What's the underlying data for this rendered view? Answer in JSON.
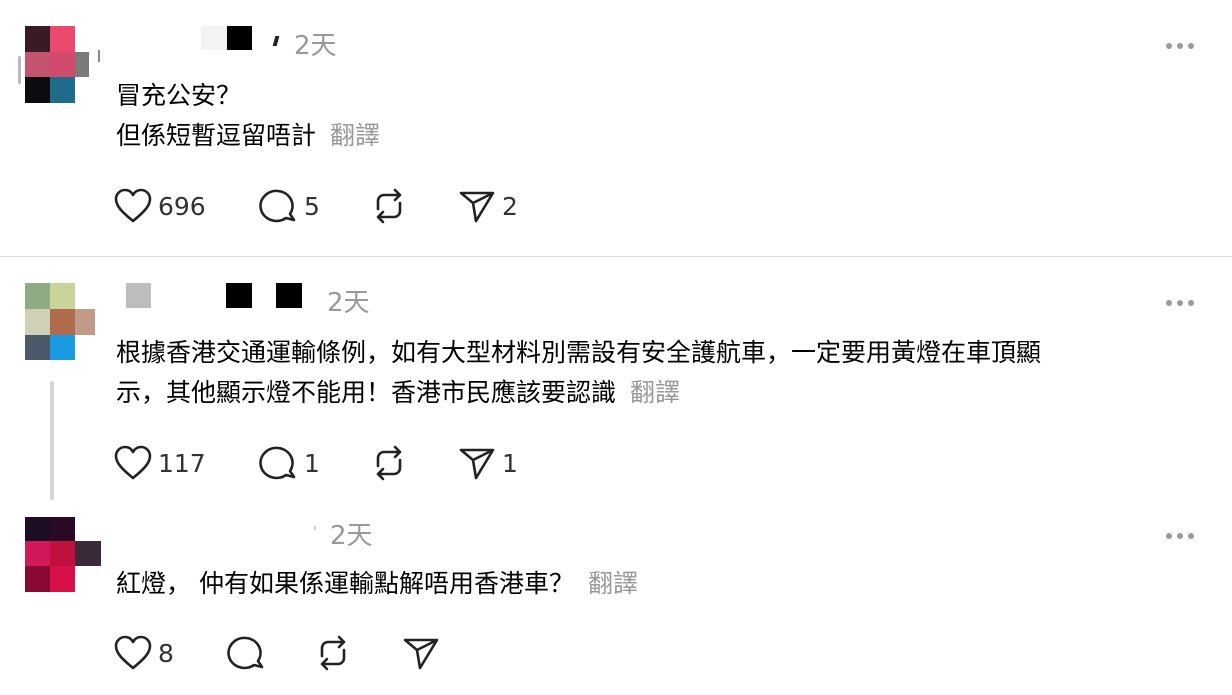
{
  "posts": [
    {
      "time": "2天",
      "lines": [
        "冒充公安？",
        "但係短暫逗留唔計"
      ],
      "translate": "翻譯",
      "likes": "696",
      "replies": "5",
      "reposts": "",
      "shares": "2"
    },
    {
      "time": "2天",
      "lines": [
        "根據香港交通運輸條例，如有大型材料別需設有安全護航車，一定要用黃燈在車頂顯",
        "示，其他顯示燈不能用！香港市民應該要認識"
      ],
      "translate": "翻譯",
      "likes": "117",
      "replies": "1",
      "reposts": "",
      "shares": "1"
    },
    {
      "time": "2天",
      "lines": [
        "紅燈， 仲有如果係運輸點解唔用香港車？"
      ],
      "translate": "翻譯",
      "likes": "8",
      "replies": "",
      "reposts": "",
      "shares": ""
    }
  ],
  "icons": {
    "like": "heart-icon",
    "reply": "comment-icon",
    "repost": "repost-icon",
    "share": "send-icon",
    "more": "more-icon"
  },
  "colors": {
    "text": "#000000",
    "muted": "#999999",
    "divider": "#d9d9d9"
  }
}
